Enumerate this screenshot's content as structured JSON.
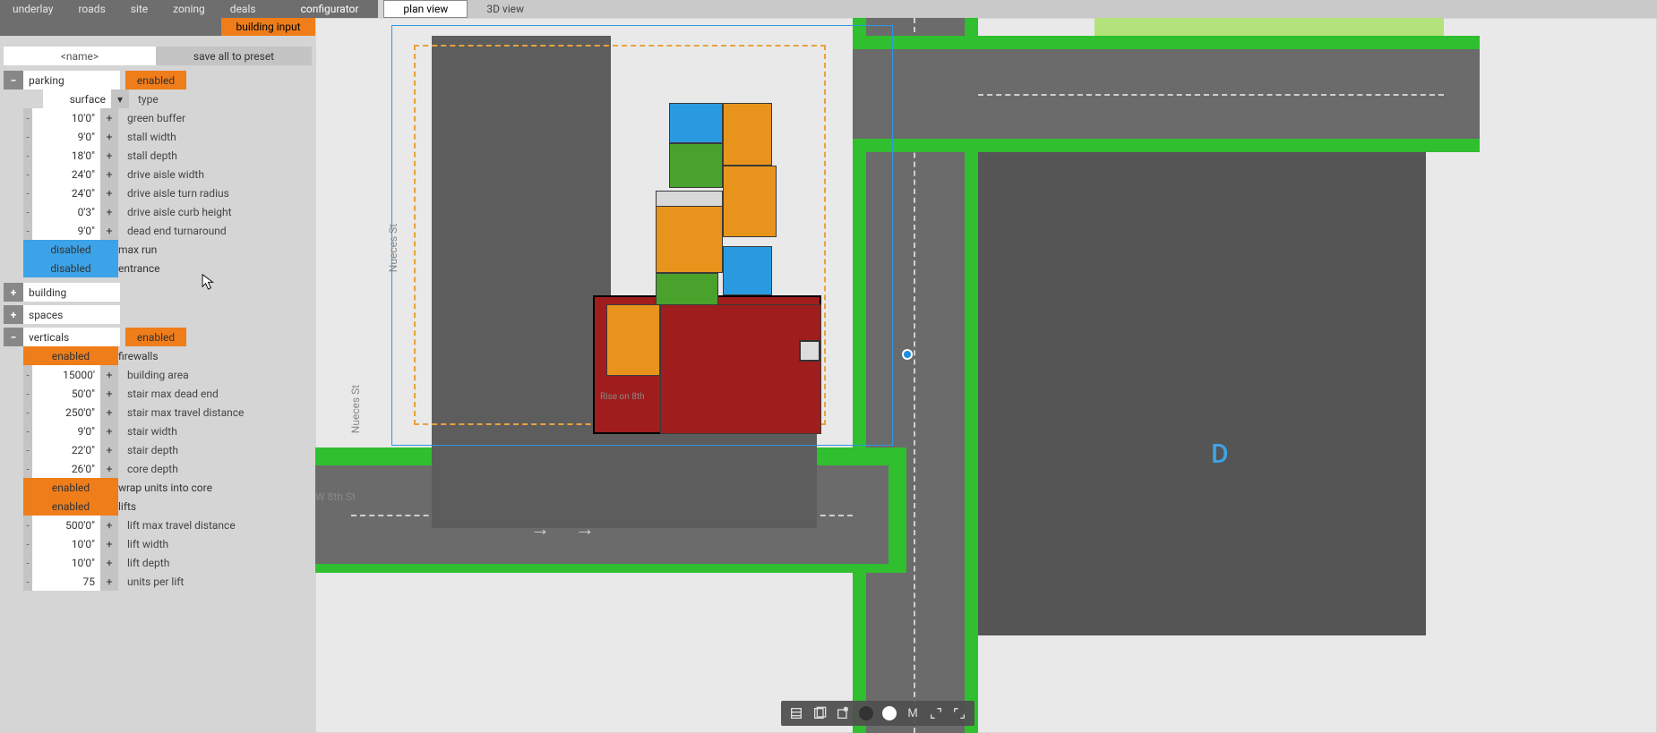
{
  "nav": {
    "tabs": [
      "underlay",
      "roads",
      "site",
      "zoning",
      "deals"
    ],
    "configurator": "configurator",
    "building_input": "building input",
    "views": {
      "plan": "plan view",
      "three_d": "3D view"
    }
  },
  "preset": {
    "name_placeholder": "<name>",
    "save_label": "save all to preset"
  },
  "sections": {
    "parking": {
      "title": "parking",
      "state": "enabled",
      "type": {
        "value": "surface",
        "label": "type"
      },
      "props": [
        {
          "value": "10'0\"",
          "label": "green buffer"
        },
        {
          "value": "9'0\"",
          "label": "stall width"
        },
        {
          "value": "18'0\"",
          "label": "stall depth"
        },
        {
          "value": "24'0\"",
          "label": "drive aisle width"
        },
        {
          "value": "24'0\"",
          "label": "drive aisle turn radius"
        },
        {
          "value": "0'3\"",
          "label": "drive aisle curb height"
        },
        {
          "value": "9'0\"",
          "label": "dead end turnaround"
        }
      ],
      "flags": [
        {
          "state": "disabled",
          "label": "max run"
        },
        {
          "state": "disabled",
          "label": "entrance"
        }
      ]
    },
    "building": {
      "title": "building"
    },
    "spaces": {
      "title": "spaces"
    },
    "verticals": {
      "title": "verticals",
      "state": "enabled",
      "firewalls": {
        "state": "enabled",
        "label": "firewalls"
      },
      "props": [
        {
          "value": "15000'",
          "label": "building area"
        },
        {
          "value": "50'0\"",
          "label": "stair max dead end"
        },
        {
          "value": "250'0\"",
          "label": "stair max travel distance"
        },
        {
          "value": "9'0\"",
          "label": "stair width"
        },
        {
          "value": "22'0\"",
          "label": "stair depth"
        },
        {
          "value": "26'0\"",
          "label": "core depth"
        }
      ],
      "flags2": [
        {
          "state": "enabled",
          "label": "wrap units into core"
        },
        {
          "state": "enabled",
          "label": "lifts"
        }
      ],
      "lifts": [
        {
          "value": "500'0\"",
          "label": "lift max travel distance"
        },
        {
          "value": "10'0\"",
          "label": "lift width"
        },
        {
          "value": "10'0\"",
          "label": "lift depth"
        },
        {
          "value": "75",
          "label": "units per lift"
        }
      ]
    }
  },
  "map": {
    "streets": {
      "nueces": "Nueces St",
      "w8th": "W 8th St",
      "rise": "Rise on 8th"
    },
    "floor_letter": "D"
  },
  "toolbar": {
    "m": "M"
  }
}
